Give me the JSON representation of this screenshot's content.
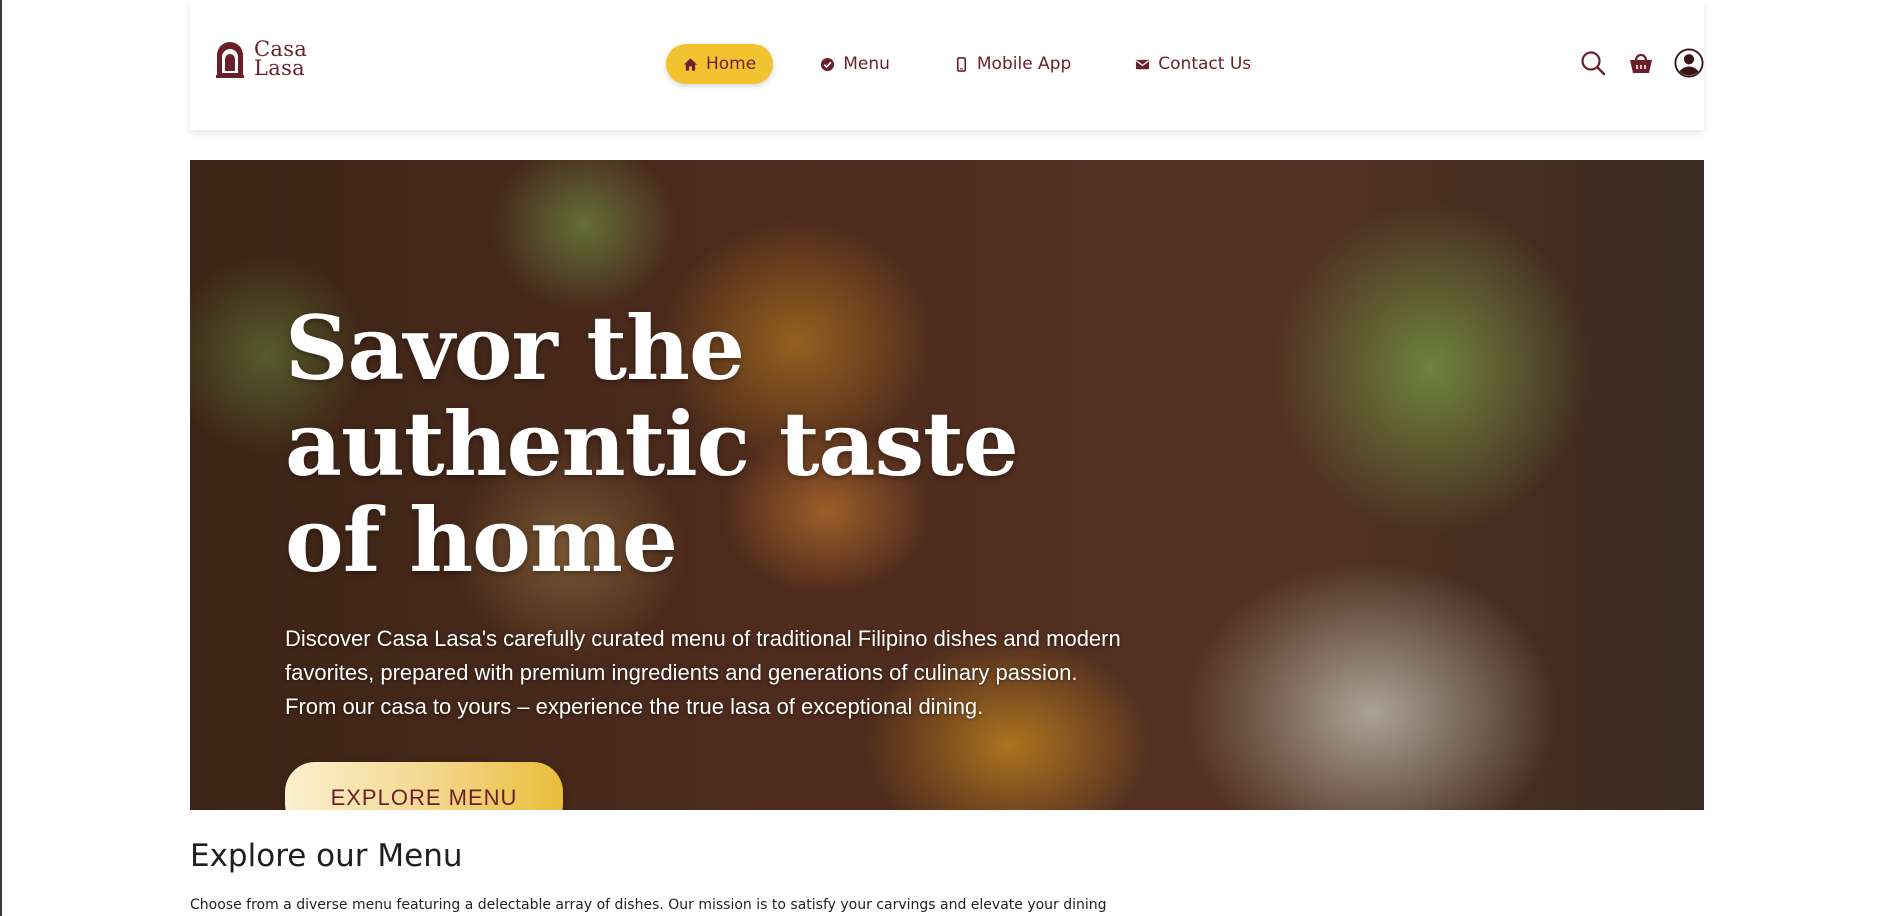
{
  "brand": {
    "line1": "Casa",
    "line2": "Lasa",
    "color": "#6b1f28",
    "accent": "#f3c230"
  },
  "nav": {
    "items": [
      {
        "label": "Home",
        "icon": "home-icon",
        "active": true
      },
      {
        "label": "Menu",
        "icon": "check-circle-icon",
        "active": false
      },
      {
        "label": "Mobile App",
        "icon": "mobile-icon",
        "active": false
      },
      {
        "label": "Contact Us",
        "icon": "mail-icon",
        "active": false
      }
    ]
  },
  "header_icons": [
    "search-icon",
    "basket-icon",
    "user-icon"
  ],
  "hero": {
    "title": "Savor the authentic taste of home",
    "subtitle": "Discover Casa Lasa's carefully curated menu of traditional Filipino dishes and modern favorites, prepared with premium ingredients and generations of culinary passion. From our casa to yours – experience the true lasa of exceptional dining.",
    "cta": "EXPLORE MENU"
  },
  "explore": {
    "title": "Explore our Menu",
    "text": "Choose from a diverse menu featuring a delectable array of dishes. Our mission is to satisfy your carvings and elevate your dining"
  }
}
